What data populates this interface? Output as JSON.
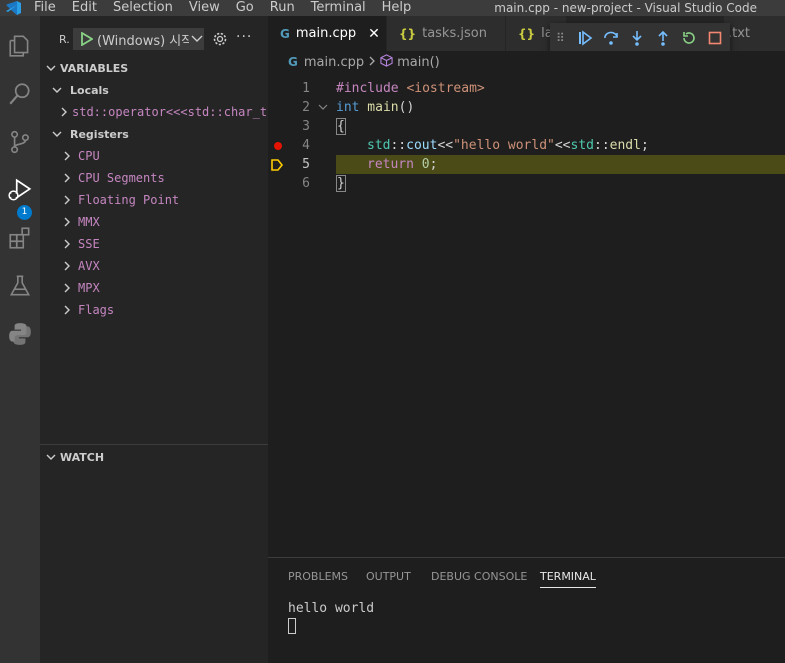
{
  "window": {
    "title": "main.cpp - new-project - Visual Studio Code"
  },
  "menu": [
    "File",
    "Edit",
    "Selection",
    "View",
    "Go",
    "Run",
    "Terminal",
    "Help"
  ],
  "activity_bar": {
    "items": [
      "explorer-icon",
      "search-icon",
      "source-control-icon",
      "run-debug-icon",
      "extensions-icon",
      "testing-icon",
      "python-icon"
    ],
    "debug_badge": "1"
  },
  "sidebar": {
    "run_label": "R.",
    "launch_config": "(Windows) 시작",
    "variables_header": "VARIABLES",
    "locals_label": "Locals",
    "locals_item": "std::operator<<<std::char_traits<char> >",
    "registers_label": "Registers",
    "registers": [
      "CPU",
      "CPU Segments",
      "Floating Point",
      "MMX",
      "SSE",
      "AVX",
      "MPX",
      "Flags"
    ],
    "watch_header": "WATCH",
    "more": "···"
  },
  "tabs": [
    {
      "label": "main.cpp",
      "icon": "G",
      "active": true,
      "close": "✕"
    },
    {
      "label": "tasks.json",
      "icon": "{}",
      "active": false
    },
    {
      "label": "la",
      "icon": "{}",
      "active": false
    },
    {
      "label": ".txt",
      "icon": "",
      "active": false
    }
  ],
  "breadcrumb": {
    "file": "main.cpp",
    "symbol": "main()"
  },
  "editor": {
    "line_numbers": [
      "1",
      "2",
      "3",
      "4",
      "5",
      "6"
    ],
    "breakpoint_line": 4,
    "current_line": 5,
    "line1": {
      "pp": "#include",
      "inc": " <iostream>"
    },
    "line2": {
      "kw": "int",
      "fn": " main",
      "pl": "()"
    },
    "line3": {
      "brace": "{"
    },
    "line4": {
      "ns1": "std",
      "op1": "::",
      "fn1": "cout",
      "op2": "<<",
      "str": "\"hello world\"",
      "op3": "<<",
      "ns2": "std",
      "op4": "::",
      "fn2": "endl",
      "semi": ";"
    },
    "line5": {
      "kw": "return",
      "num": " 0",
      "semi": ";"
    },
    "line6": {
      "brace": "}"
    }
  },
  "panel": {
    "tabs": [
      "PROBLEMS",
      "OUTPUT",
      "DEBUG CONSOLE",
      "TERMINAL"
    ],
    "active_tab": "TERMINAL",
    "terminal_output": "hello world"
  },
  "colors": {
    "accent": "#007acc",
    "breakpoint": "#e51400",
    "current_line_highlight": "#4b4b18",
    "debug_icon_blue": "#75beff",
    "debug_restart_green": "#89d185",
    "debug_stop_red": "#f48771"
  }
}
